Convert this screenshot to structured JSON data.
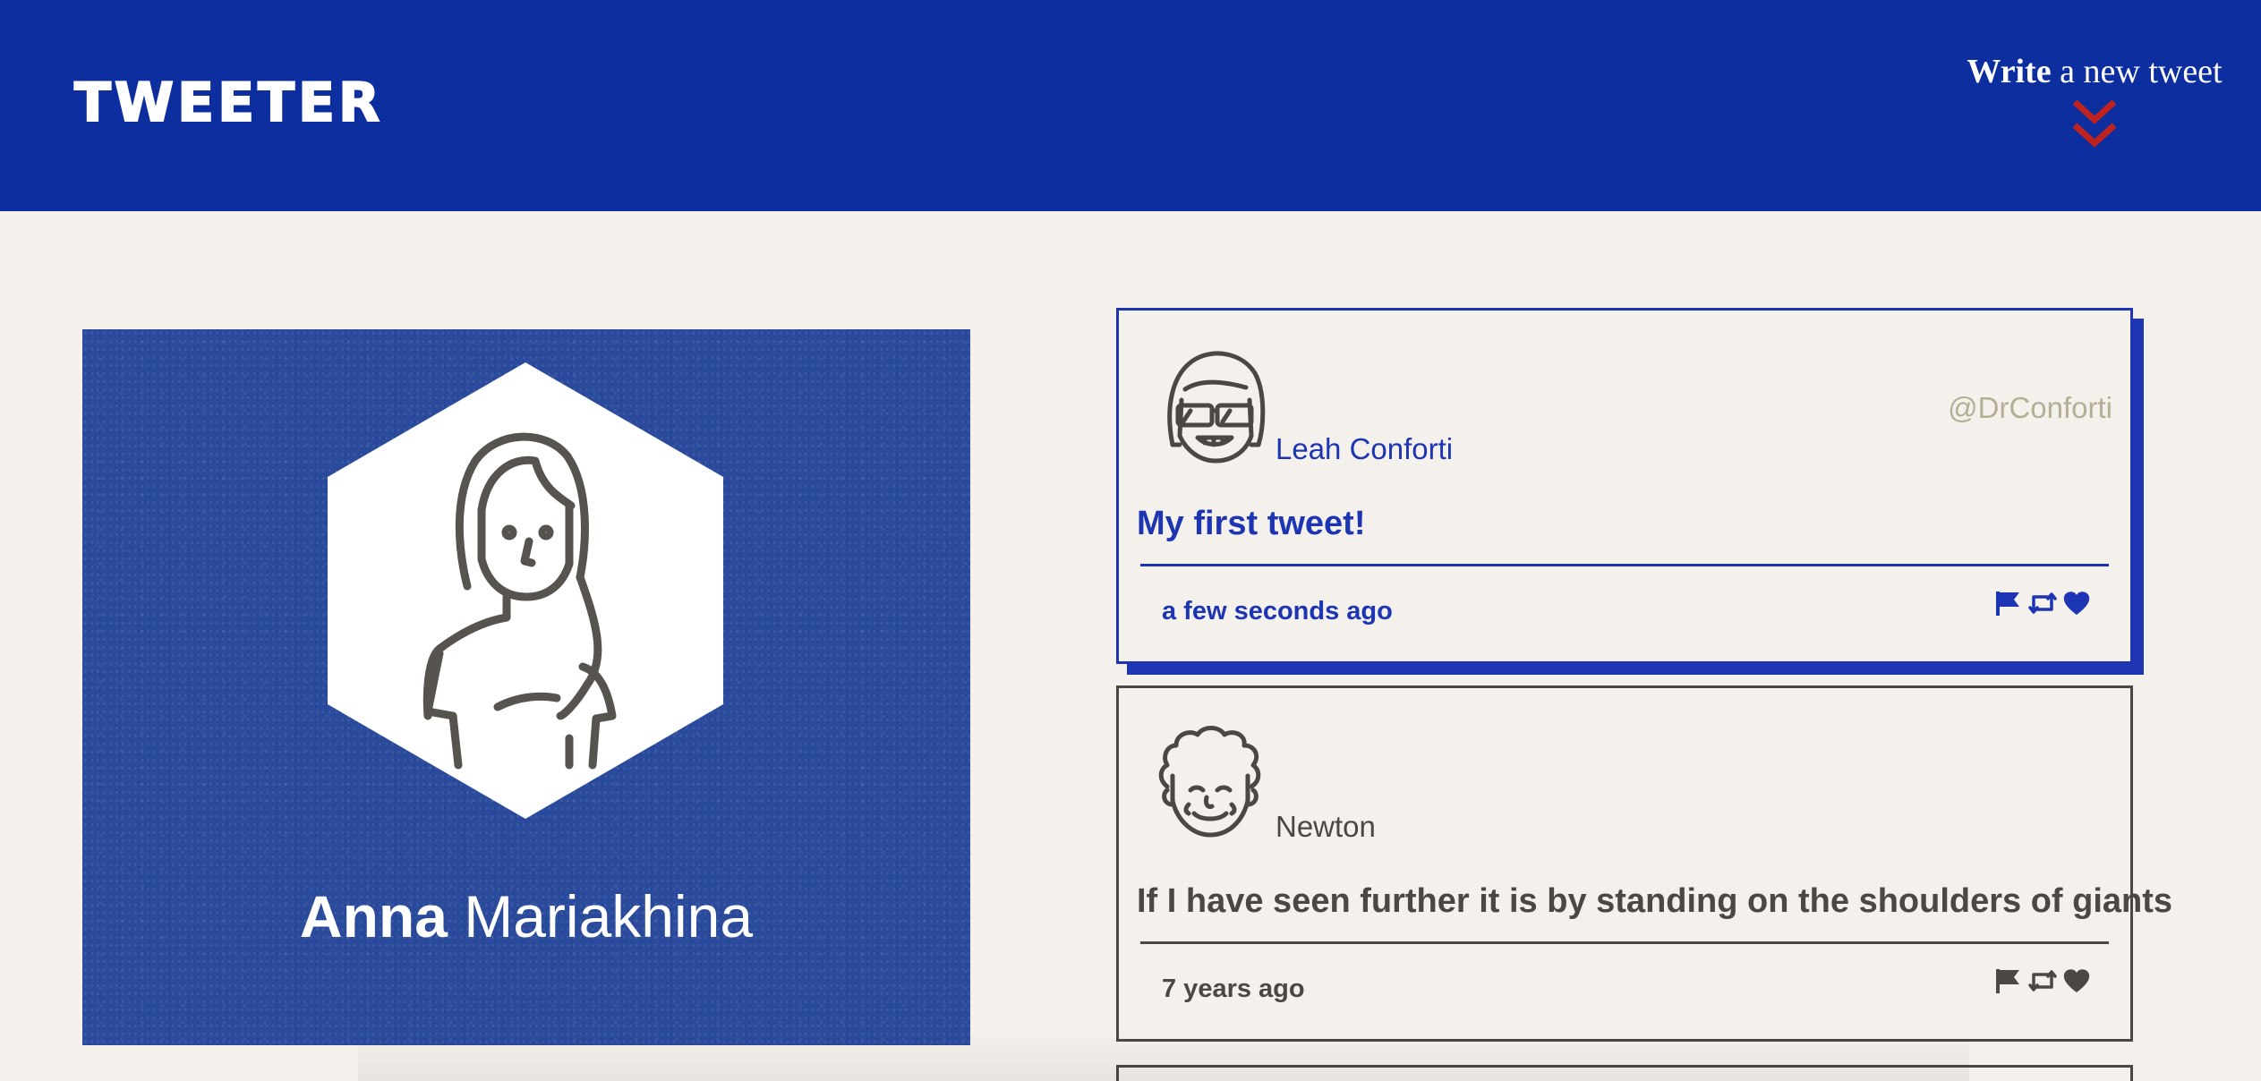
{
  "nav": {
    "logo": "TWEETER",
    "write_bold": "Write",
    "write_rest": " a new tweet",
    "compose_icon": "double-chevron-down-icon"
  },
  "profile": {
    "first_name": "Anna",
    "last_name": "Mariakhina",
    "avatar_icon": "woman-avatar-icon"
  },
  "tweets": [
    {
      "author": "Leah Conforti",
      "handle": "@DrConforti",
      "content": "My first tweet!",
      "time": "a few seconds ago",
      "avatar_icon": "sunglasses-girl-avatar-icon"
    },
    {
      "author": "Newton",
      "handle": "",
      "content": "If I have seen further it is by standing on the shoulders of giants",
      "time": "7 years ago",
      "avatar_icon": "curly-hair-man-avatar-icon"
    }
  ],
  "actions": [
    "flag-icon",
    "retweet-icon",
    "heart-icon"
  ],
  "colors": {
    "nav": "#0c2e9e",
    "accent": "#1d35b3",
    "chevron": "#c0221f",
    "background": "#f4f1ec",
    "text": "#4a4744",
    "handle": "#b4ae95"
  }
}
